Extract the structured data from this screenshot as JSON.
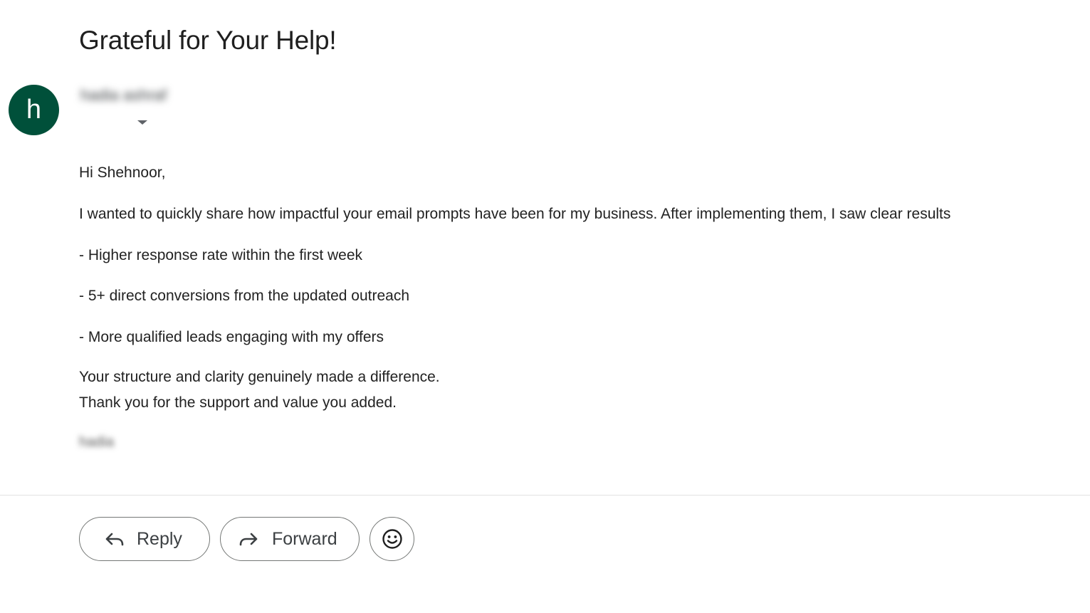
{
  "email": {
    "subject": "Grateful for Your Help!",
    "sender": {
      "avatar_letter": "h",
      "avatar_color": "#00503a",
      "name": "hadia ashraf"
    },
    "body": {
      "greeting": "Hi Shehnoor,",
      "intro": "I wanted to quickly share how impactful your email prompts have been for my business. After implementing them, I saw clear results",
      "bullets": [
        "- Higher response rate within the first week",
        "- 5+ direct conversions from the updated outreach",
        "- More qualified leads engaging with my offers"
      ],
      "closing_line_1": "Your structure and clarity genuinely made a difference.",
      "closing_line_2": "Thank you for the support and value you added.",
      "signature": "hadia"
    }
  },
  "actions": {
    "reply_label": "Reply",
    "forward_label": "Forward",
    "reply_icon": "reply-arrow-icon",
    "forward_icon": "forward-arrow-icon",
    "emoji_icon": "smiley-face-icon"
  }
}
